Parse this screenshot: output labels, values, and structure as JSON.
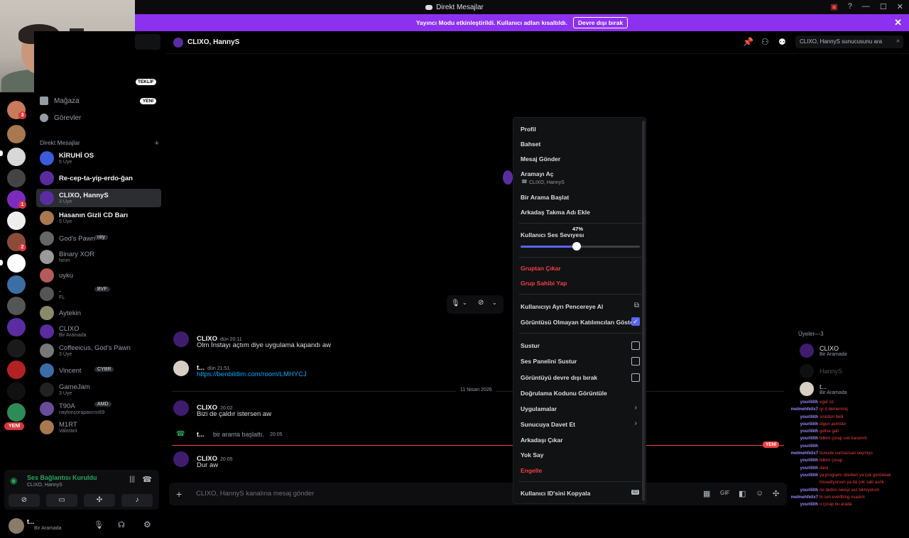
{
  "window": {
    "title": "Direkt Mesajlar"
  },
  "banner": {
    "text": "Yayıncı Modu etkinleştirildi. Kullanıcı adları kısaltıldı.",
    "button": "Devre dışı bırak"
  },
  "sidebar": {
    "teklif": "TEKLİF",
    "nav": [
      {
        "label": "Mağaza",
        "tag": "YENİ"
      },
      {
        "label": "Görevler"
      }
    ],
    "dm_header": "Direkt Mesajlar",
    "dms": [
      {
        "name": "KİRUHİ OS",
        "sub": "5 Üye"
      },
      {
        "name": "Re-cep-ta-yip-erdo-ğan",
        "sub": ""
      },
      {
        "name": "CLIXO, HannyS",
        "sub": "3 Üye"
      },
      {
        "name": "Hasanın Gizli CD Barı",
        "sub": "5 Üye"
      },
      {
        "name": "God's Pawn",
        "sub": "",
        "tag": "nity"
      },
      {
        "name": "Binary XOR",
        "sub": "hmm"
      },
      {
        "name": "uyku",
        "sub": ""
      },
      {
        "name": "-",
        "sub": "FL",
        "tag": "BVF"
      },
      {
        "name": "Aytekin",
        "sub": ""
      },
      {
        "name": "CLIXO",
        "sub": "Bir Aramada"
      },
      {
        "name": "Coffeeicus, God's Pawn",
        "sub": "3 Üye"
      },
      {
        "name": "Vincent",
        "sub": "",
        "tag": "CYBR"
      },
      {
        "name": "GameJam",
        "sub": "3 Üye"
      },
      {
        "name": "T90A",
        "sub": "naylonçorapavcısı69",
        "tag": "AMD"
      },
      {
        "name": "M1RT",
        "sub": "Valorant"
      }
    ],
    "server_new": "YENİ",
    "voice": {
      "status": "Ses Bağlantısı Kuruldu",
      "channel": "CLIXO, HannyS"
    },
    "user": {
      "name": "t...",
      "status": "Bir Aramada"
    }
  },
  "channel": {
    "title": "CLIXO, HannyS",
    "search_placeholder": "CLIXO, HannyS sunucusunu ara",
    "composer_placeholder": "CLIXO, HannyS kanalına mesaj gönder",
    "date_divider": "11 Nisan 2026",
    "new_label": "YENİ",
    "messages": [
      {
        "name": "CLIXO",
        "time": "dün 20:11",
        "text": "Olm İnstayı açtım diye uygulama kapandı aw"
      },
      {
        "name": "t...",
        "time": "dün 21:51",
        "text": "https://benbildim.com/room/LMHYCJ"
      },
      {
        "name": "CLIXO",
        "time": "20:02",
        "text": "Bizi de çaldır istersen aw"
      },
      {
        "name": "t...",
        "time": "20:05",
        "text": "bir arama başlattı."
      },
      {
        "name": "CLIXO",
        "time": "20:05",
        "text": "Dur aw"
      }
    ]
  },
  "members": {
    "header": "Üyeler—3",
    "list": [
      {
        "name": "CLIXO",
        "sub": "Bir Aramada"
      },
      {
        "name": "HannyS",
        "sub": ""
      },
      {
        "name": "t...",
        "sub": "Bir Aramada"
      }
    ]
  },
  "stream_chat": [
    {
      "user": "yourlilith",
      "text": "eger oz"
    },
    {
      "user": "metmehfelix7",
      "text": "iyi d demenmiş"
    },
    {
      "user": "yourlilith",
      "text": "sinirden belli"
    },
    {
      "user": "yourlilith",
      "text": "olgun asmiste"
    },
    {
      "user": "yourlilith",
      "text": "gelise gati"
    },
    {
      "user": "yourlilith",
      "text": "bilkim çorap son karanım"
    },
    {
      "user": "yourlilith",
      "text": ""
    },
    {
      "user": "metmehfelix7",
      "text": "bunuda sormazsan seçmiyo"
    },
    {
      "user": "yourlilith",
      "text": "bilkim çorap"
    },
    {
      "user": "yourlilith",
      "text": "diesi"
    },
    {
      "user": "yourlilith",
      "text": "ya programı izlerken ya çok gerizekalı"
    },
    {
      "user": "",
      "text": "hissediyorsun ya da çok saki asrik"
    },
    {
      "user": "yourlilith",
      "text": "ne dediın nereyi sez bilmiyorum"
    },
    {
      "user": "metmehfelix7",
      "text": "bi sen everthing oxadım"
    },
    {
      "user": "yourlilith",
      "text": "o çorap bu arada"
    }
  ],
  "context_menu": {
    "items": [
      {
        "label": "Profil"
      },
      {
        "label": "Bahset"
      },
      {
        "label": "Mesaj Gönder"
      },
      {
        "label": "Aramayı Aç",
        "sub": "CLIXO, HannyS"
      },
      {
        "label": "Bir Arama Başlat"
      },
      {
        "label": "Arkadaş Takma Adı Ekle"
      }
    ],
    "volume": {
      "label": "Kullanıcı Ses Seviyesi",
      "tooltip": "47%",
      "value": 0.47
    },
    "group_items": [
      {
        "label": "Gruptan Çıkar"
      },
      {
        "label": "Grup Sahibi Yap"
      }
    ],
    "popout": "Kullanıcıyı Ayrı Pencereye Al",
    "show_nonvideo": "Görüntüsü Olmayan Katılımcıları Göster",
    "mute": "Sustur",
    "mute_soundboard": "Ses Panelini Sustur",
    "disable_video": "Görüntüyü devre dışı bırak",
    "verify_code": "Doğrulama Kodunu Görüntüle",
    "apps": "Uygulamalar",
    "invite": "Sunucuya Davet Et",
    "remove_friend": "Arkadaşı Çıkar",
    "ignore": "Yok Say",
    "block": "Engelle",
    "copy_id": "Kullanıcı ID'sini Kopyala"
  }
}
